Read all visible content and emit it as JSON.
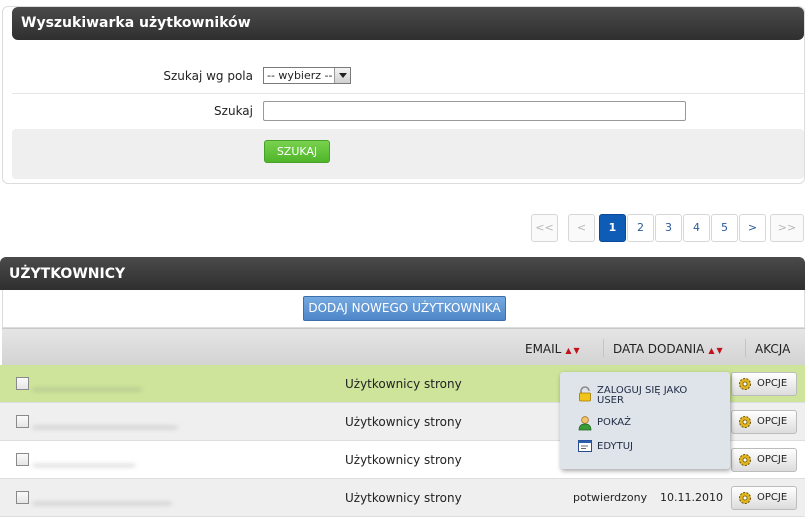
{
  "search": {
    "title": "Wyszukiwarka użytkowników",
    "field_label": "Szukaj wg pola",
    "field_select_value": "-- wybierz --",
    "query_label": "Szukaj",
    "query_value": "",
    "submit_label": "SZUKAJ"
  },
  "pagination": {
    "first": "<<",
    "prev": "<",
    "pages": [
      "1",
      "2",
      "3",
      "4",
      "5"
    ],
    "current": "1",
    "next": ">",
    "last": ">>"
  },
  "users": {
    "title": "UŻYTKOWNICY",
    "add_button": "DODAJ NOWEGO UŻYTKOWNIKA",
    "columns": {
      "email": "EMAIL",
      "date_added": "DATA DODANIA",
      "action": "AKCJA"
    },
    "rows": [
      {
        "role": "Użytkownicy strony",
        "status": "",
        "date": "",
        "options": "OPCJE"
      },
      {
        "role": "Użytkownicy strony",
        "status": "",
        "date": "",
        "options": "OPCJE"
      },
      {
        "role": "Użytkownicy strony",
        "status": "",
        "date": "",
        "options": "OPCJE"
      },
      {
        "role": "Użytkownicy strony",
        "status": "potwierdzony",
        "date": "10.11.2010",
        "options": "OPCJE"
      }
    ],
    "popup_menu": [
      "ZALOGUJ SIĘ JAKO USER",
      "POKAŻ",
      "EDYTUJ"
    ]
  },
  "icons": {
    "sort": "sort-arrows-icon",
    "gear": "gear-icon",
    "login": "padlock-icon",
    "show": "user-icon",
    "edit": "edit-window-icon",
    "select": "dropdown-arrow-icon"
  },
  "colors": {
    "header_dark": "#333333",
    "search_button": "#5dbb33",
    "add_button": "#5a93d1",
    "pagination_active": "#0e5cb5",
    "row_highlight": "#cde49a",
    "sort_arrow": "#c1121c"
  }
}
